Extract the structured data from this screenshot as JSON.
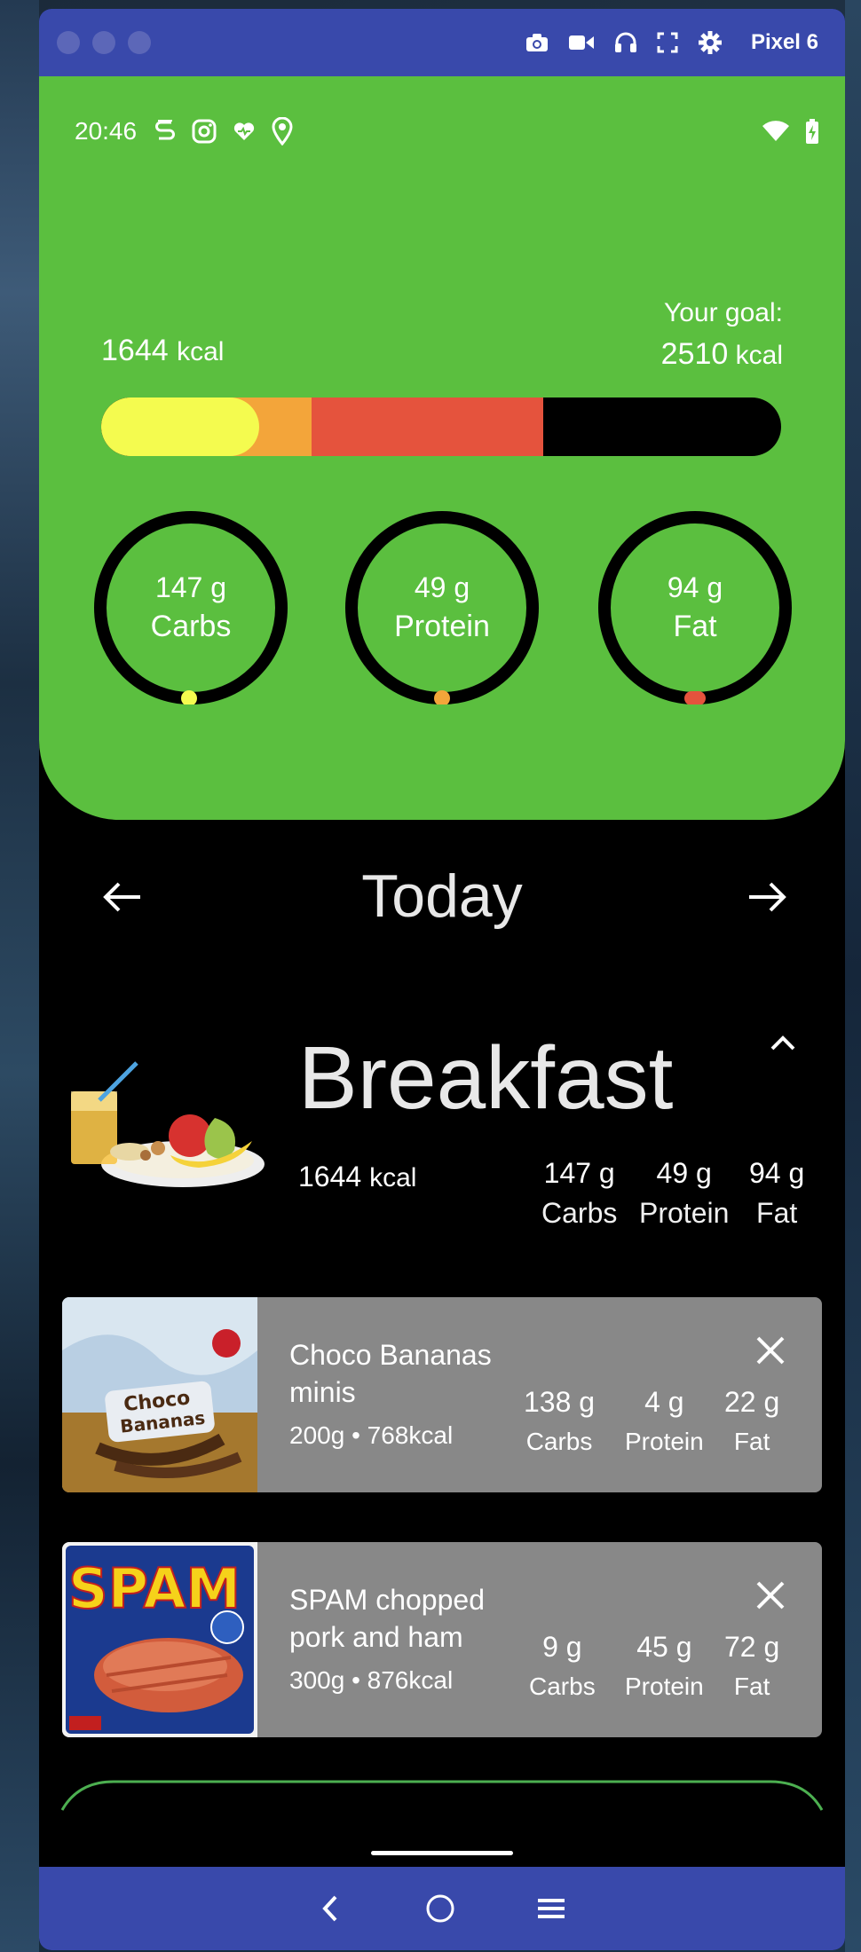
{
  "window": {
    "device_name": "Pixel 6"
  },
  "status_bar": {
    "time": "20:46"
  },
  "summary": {
    "current_kcal_value": "1644",
    "current_kcal_unit": "kcal",
    "goal_label": "Your goal:",
    "goal_value": "2510",
    "goal_unit": "kcal",
    "progress_fractions": {
      "carbs_end": 0.233,
      "protein_end": 0.31,
      "fat_end": 0.65
    },
    "colors": {
      "carbs": "#f4fb4f",
      "protein": "#f3a53a",
      "fat": "#e5533d",
      "background": "#5bbf3f"
    },
    "rings": [
      {
        "value": "147 g",
        "label": "Carbs",
        "dot_color": "#f4fb4f"
      },
      {
        "value": "49 g",
        "label": "Protein",
        "dot_color": "#f3a53a"
      },
      {
        "value": "94 g",
        "label": "Fat",
        "dot_color": "#e5533d"
      }
    ]
  },
  "day_nav": {
    "title": "Today"
  },
  "meal": {
    "title": "Breakfast",
    "kcal_value": "1644",
    "kcal_unit": "kcal",
    "macros": [
      {
        "value": "147 g",
        "label": "Carbs"
      },
      {
        "value": "49 g",
        "label": "Protein"
      },
      {
        "value": "94 g",
        "label": "Fat"
      }
    ]
  },
  "foods": [
    {
      "name": "Choco Bananas minis",
      "meta": "200g • 768kcal",
      "image_text": [
        "Choco",
        "Bananas"
      ],
      "macros": [
        {
          "value": "138 g",
          "label": "Carbs"
        },
        {
          "value": "4 g",
          "label": "Protein"
        },
        {
          "value": "22 g",
          "label": "Fat"
        }
      ]
    },
    {
      "name": "SPAM chopped pork and ham",
      "meta": "300g • 876kcal",
      "image_text": [
        "SPAM"
      ],
      "macros": [
        {
          "value": "9 g",
          "label": "Carbs"
        },
        {
          "value": "45 g",
          "label": "Protein"
        },
        {
          "value": "72 g",
          "label": "Fat"
        }
      ]
    }
  ]
}
